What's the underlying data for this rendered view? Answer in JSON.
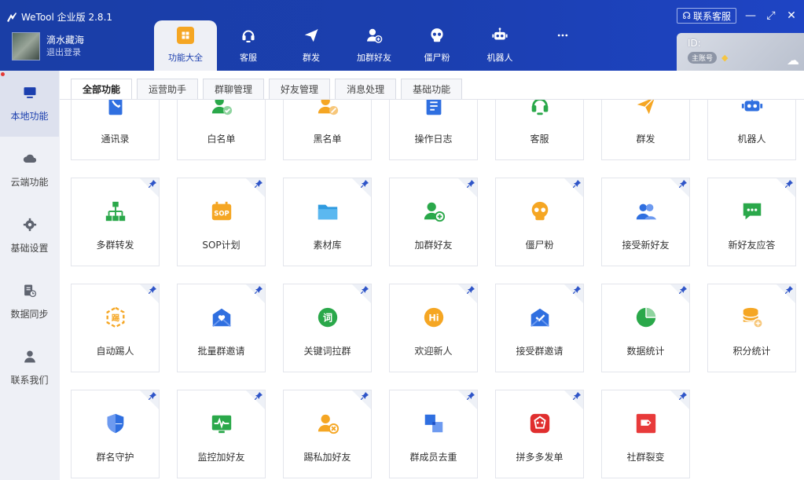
{
  "app": {
    "title": "WeTool 企业版 2.8.1"
  },
  "user": {
    "name": "滴水藏海",
    "logout": "退出登录"
  },
  "nav": [
    {
      "label": "功能大全",
      "icon": "grid-icon",
      "active": true
    },
    {
      "label": "客服",
      "icon": "headset-icon"
    },
    {
      "label": "群发",
      "icon": "paper-plane-icon"
    },
    {
      "label": "加群好友",
      "icon": "add-friend-icon"
    },
    {
      "label": "僵尸粉",
      "icon": "skull-icon"
    },
    {
      "label": "机器人",
      "icon": "robot-icon"
    },
    {
      "label": "",
      "icon": "more-icon"
    }
  ],
  "service_button": "联系客服",
  "account": {
    "id_label": "ID:",
    "badge": "主账号"
  },
  "sidebar": [
    {
      "label": "本地功能",
      "icon": "monitor-icon",
      "active": true
    },
    {
      "label": "云端功能",
      "icon": "cloud-icon"
    },
    {
      "label": "基础设置",
      "icon": "gear-icon"
    },
    {
      "label": "数据同步",
      "icon": "sync-icon"
    },
    {
      "label": "联系我们",
      "icon": "person-icon"
    }
  ],
  "tabs": [
    "全部功能",
    "运营助手",
    "群聊管理",
    "好友管理",
    "消息处理",
    "基础功能"
  ],
  "rows": [
    [
      {
        "label": "通讯录",
        "icon": "contacts-icon",
        "color": "#2f6fe0"
      },
      {
        "label": "白名单",
        "icon": "whitelist-icon",
        "color": "#2aa84a"
      },
      {
        "label": "黑名单",
        "icon": "blacklist-icon",
        "color": "#f5a623"
      },
      {
        "label": "操作日志",
        "icon": "log-icon",
        "color": "#2f6fe0"
      },
      {
        "label": "客服",
        "icon": "headset-icon",
        "color": "#2aa84a"
      },
      {
        "label": "群发",
        "icon": "paper-plane-icon",
        "color": "#f5a623"
      },
      {
        "label": "机器人",
        "icon": "robot-icon",
        "color": "#2f6fe0"
      }
    ],
    [
      {
        "label": "多群转发",
        "icon": "org-chart-icon",
        "color": "#2aa84a"
      },
      {
        "label": "SOP计划",
        "icon": "sop-icon",
        "color": "#f5a623"
      },
      {
        "label": "素材库",
        "icon": "folder-icon",
        "color": "#2f9be0"
      },
      {
        "label": "加群好友",
        "icon": "add-friend-icon",
        "color": "#2aa84a"
      },
      {
        "label": "僵尸粉",
        "icon": "skull-icon",
        "color": "#f5a623"
      },
      {
        "label": "接受新好友",
        "icon": "users-icon",
        "color": "#2f6fe0"
      },
      {
        "label": "新好友应答",
        "icon": "chat-icon",
        "color": "#2aa84a"
      }
    ],
    [
      {
        "label": "自动踢人",
        "icon": "kick-icon",
        "color": "#f5a623"
      },
      {
        "label": "批量群邀请",
        "icon": "invite-icon",
        "color": "#2f6fe0"
      },
      {
        "label": "关键词拉群",
        "icon": "keyword-icon",
        "color": "#2aa84a"
      },
      {
        "label": "欢迎新人",
        "icon": "hi-icon",
        "color": "#f5a623"
      },
      {
        "label": "接受群邀请",
        "icon": "accept-invite-icon",
        "color": "#2f6fe0"
      },
      {
        "label": "数据统计",
        "icon": "pie-icon",
        "color": "#2aa84a"
      },
      {
        "label": "积分统计",
        "icon": "coins-icon",
        "color": "#f5a623"
      }
    ],
    [
      {
        "label": "群名守护",
        "icon": "shield-icon",
        "color": "#2f6fe0"
      },
      {
        "label": "监控加好友",
        "icon": "monitor-pulse-icon",
        "color": "#2aa84a"
      },
      {
        "label": "踢私加好友",
        "icon": "kick-user-icon",
        "color": "#f5a623"
      },
      {
        "label": "群成员去重",
        "icon": "dedupe-icon",
        "color": "#2f6fe0"
      },
      {
        "label": "拼多多发单",
        "icon": "pdd-icon",
        "color": "#e02e2e"
      },
      {
        "label": "社群裂变",
        "icon": "fission-icon",
        "color": "#e83a3a"
      }
    ]
  ],
  "pin_glyph": "📌"
}
